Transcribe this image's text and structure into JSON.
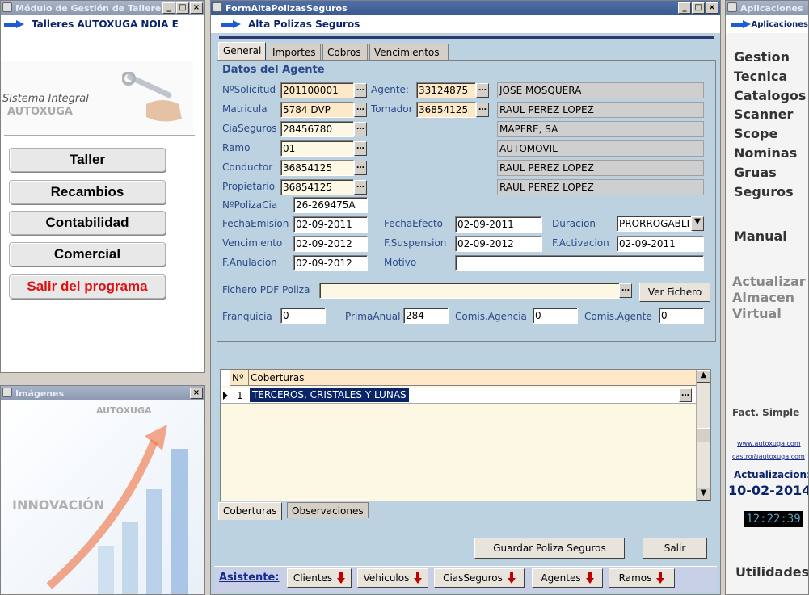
{
  "left_window": {
    "title": "Módulo de Gestión de Talleres",
    "subheader": "Talleres AUTOXUGA NOIA E",
    "logo_line1": "Sistema Integral",
    "logo_line2": "AUTOXUGA",
    "menu": [
      "Taller",
      "Recambios",
      "Contabilidad",
      "Comercial",
      "Salir del programa"
    ]
  },
  "images_window": {
    "title": "Imágenes",
    "brand": "AUTOXUGA",
    "caption": "INNOVACIÓN"
  },
  "main_window": {
    "title": "FormAltaPolizasSeguros",
    "subheader": "Alta Polizas Seguros",
    "tabs": [
      "General",
      "Importes",
      "Cobros",
      "Vencimientos"
    ],
    "section_title": "Datos del Agente",
    "labels": {
      "nsolicitud": "NºSolicitud",
      "matricula": "Matricula",
      "ciaseguros": "CiaSeguros",
      "ramo": "Ramo",
      "conductor": "Conductor",
      "propietario": "Propietario",
      "npolizacia": "NºPolizaCia",
      "fechaemision": "FechaEmision",
      "vencimiento": "Vencimiento",
      "fanulacion": "F.Anulacion",
      "agente": "Agente:",
      "tomador": "Tomador",
      "fechaefecto": "FechaEfecto",
      "fsuspension": "F.Suspension",
      "motivo": "Motivo",
      "duracion": "Duracion",
      "factivacion": "F.Activacion",
      "fichero": "Fichero PDF Poliza",
      "franquicia": "Franquicia",
      "primaanual": "PrimaAnual",
      "comisagencia": "Comis.Agencia",
      "comisagente": "Comis.Agente"
    },
    "values": {
      "nsolicitud": "201100001",
      "matricula": "5784 DVP",
      "ciaseguros": "28456780",
      "ramo": "01",
      "conductor": "36854125",
      "propietario": "36854125",
      "npolizacia": "26-269475A",
      "fechaemision": "02-09-2011",
      "vencimiento": "02-09-2012",
      "fanulacion": "02-09-2012",
      "agente": "33124875",
      "tomador": "36854125",
      "fechaefecto": "02-09-2011",
      "fsuspension": "02-09-2012",
      "motivo": "",
      "duracion": "PRORROGABLI",
      "factivacion": "02-09-2011",
      "fichero": "",
      "franquicia": "0",
      "primaanual": "284",
      "comisagencia": "0",
      "comisagente": "0"
    },
    "names": [
      "JOSE MOSQUERA",
      "RAUL PEREZ LOPEZ",
      "MAPFRE, SA",
      "AUTOMOVIL",
      "RAUL PEREZ LOPEZ",
      "RAUL PEREZ LOPEZ"
    ],
    "ver_fichero": "Ver Fichero",
    "grid": {
      "col_n": "Nº",
      "col_cob": "Coberturas",
      "rows": [
        {
          "n": "1",
          "cob": "TERCEROS, CRISTALES Y LUNAS"
        }
      ]
    },
    "bottom_tabs": [
      "Coberturas",
      "Observaciones"
    ],
    "guardar": "Guardar Poliza Seguros",
    "salir": "Salir",
    "asistente": "Asistente:",
    "asistente_btns": [
      "Clientes",
      "Vehiculos",
      "CiasSeguros",
      "Agentes",
      "Ramos"
    ]
  },
  "right_window": {
    "title": "Aplicaciones",
    "subheader": "Aplicaciones",
    "menu": [
      "Gestion",
      "Tecnica",
      "Catalogos",
      "Scanner",
      "Scope",
      "Nominas",
      "Gruas",
      "Seguros"
    ],
    "manual": "Manual",
    "actualizar": [
      "Actualizar",
      "Almacen",
      "Virtual"
    ],
    "fact": "Fact. Simple",
    "web": "www.autoxuga.com",
    "email": "castro@autoxuga.com",
    "actualizacion_label": "Actualizacion:",
    "actualizacion_date": "10-02-2014",
    "clock": "12:22:39",
    "utilidades": "Utilidades"
  }
}
